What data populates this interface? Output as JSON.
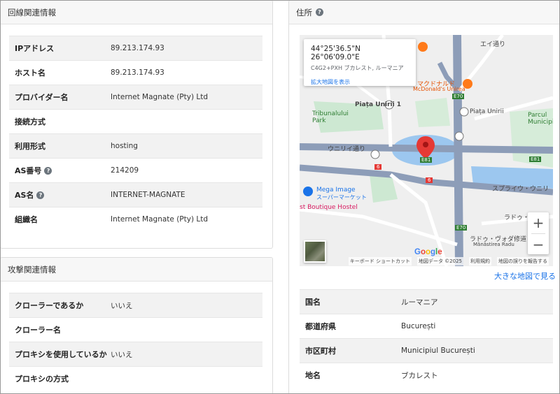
{
  "line_section": {
    "title": "回線関連情報",
    "rows": [
      {
        "label": "IPアドレス",
        "value": "89.213.174.93"
      },
      {
        "label": "ホスト名",
        "value": "89.213.174.93"
      },
      {
        "label": "プロバイダー名",
        "value": "Internet Magnate (Pty) Ltd"
      },
      {
        "label": "接続方式",
        "value": ""
      },
      {
        "label": "利用形式",
        "value": "hosting"
      },
      {
        "label": "AS番号",
        "value": "214209",
        "help": true
      },
      {
        "label": "AS名",
        "value": "INTERNET-MAGNATE",
        "help": true
      },
      {
        "label": "組織名",
        "value": "Internet Magnate (Pty) Ltd"
      }
    ]
  },
  "attack_section": {
    "title": "攻撃関連情報",
    "rows": [
      {
        "label": "クローラーであるか",
        "value": "いいえ"
      },
      {
        "label": "クローラー名",
        "value": ""
      },
      {
        "label": "プロキシを使用しているか",
        "value": "いいえ"
      },
      {
        "label": "プロキシの方式",
        "value": ""
      }
    ]
  },
  "address_section": {
    "title": "住所",
    "help_glyph": "?",
    "map": {
      "coords": "44°25'36.5\"N 26°06'09.0\"E",
      "plus_code": "C4G2+PXH ブカレスト, ルーマニア",
      "larger_map_link": "拡大地図を表示",
      "zoom_in": "+",
      "zoom_out": "−",
      "google": "Google",
      "footer": [
        "キーボード ショートカット",
        "地図データ ©2025",
        "利用規約",
        "地図の誤りを報告する"
      ],
      "labels": {
        "piata_unirii_1": "Piața Unirii 1",
        "tribunalului": "Tribunalului\nPark",
        "unirii_dori": "ウニリイ通り",
        "mcdonalds_jp": "マクドナルド",
        "mcdonalds_en": "McDonald's Unirea",
        "piata_unirii_right": "Piața Unirii",
        "parcul_unirii": "Parcul\nMunicipiul",
        "mega_image": "Mega Image",
        "mega_image_sub": "スーパーマーケット",
        "hostel": "st Boutique Hostel",
        "splaiul": "スプライウ・ウニリ",
        "radu_voda": "ラドゥ・ヴォダ修道",
        "radu_voda_en": "Mănăstirea Radu",
        "radu_street": "ラドゥ・",
        "ei_street": "エイ通り",
        "e70_a": "E70",
        "e70_b": "E70",
        "e81_a": "E81",
        "e81_b": "E81",
        "r6_a": "6",
        "r6_b": "6"
      }
    },
    "view_bigger_map": "大きな地図で見る",
    "rows": [
      {
        "label": "国名",
        "value": "ルーマニア"
      },
      {
        "label": "都道府県",
        "value": "București"
      },
      {
        "label": "市区町村",
        "value": "Municipiul București"
      },
      {
        "label": "地名",
        "value": "ブカレスト"
      }
    ]
  },
  "colors": {
    "road_major": "#8d9db8",
    "road_minor": "#ffffff",
    "park": "#cde8d2",
    "water": "#9cc7ef",
    "pin": "#e53935",
    "link": "#1a73e8"
  }
}
